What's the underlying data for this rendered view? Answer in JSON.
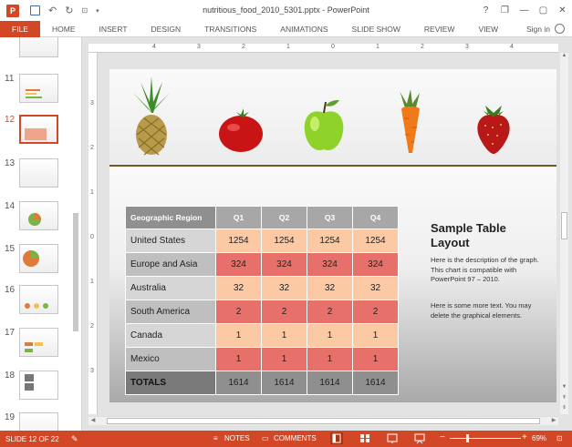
{
  "window": {
    "title": "nutritious_food_2010_5301.pptx - PowerPoint",
    "help": "?",
    "minimize": "—",
    "restore": "❐",
    "close": "✕"
  },
  "ribbon": {
    "file": "FILE",
    "tabs": [
      "HOME",
      "INSERT",
      "DESIGN",
      "TRANSITIONS",
      "ANIMATIONS",
      "SLIDE SHOW",
      "REVIEW",
      "VIEW"
    ],
    "signin": "Sign in"
  },
  "thumbnails": [
    {
      "num": "11",
      "active": false
    },
    {
      "num": "12",
      "active": true
    },
    {
      "num": "13",
      "active": false
    },
    {
      "num": "14",
      "active": false
    },
    {
      "num": "15",
      "active": false
    },
    {
      "num": "16",
      "active": false
    },
    {
      "num": "17",
      "active": false
    },
    {
      "num": "18",
      "active": false
    },
    {
      "num": "19",
      "active": false
    }
  ],
  "ruler": {
    "top_labels": [
      "4",
      "3",
      "2",
      "1",
      "0",
      "1",
      "2",
      "3",
      "4"
    ],
    "left_labels": [
      "3",
      "2",
      "1",
      "0",
      "1",
      "2",
      "3"
    ]
  },
  "slide": {
    "side_title": "Sample Table Layout",
    "side_desc": "Here is the description of the graph.  This chart is compatible with PowerPoint 97 – 2010.",
    "side_desc2": "Here is some more text.  You may delete the graphical elements.",
    "table": {
      "headers": [
        "Geographic Region",
        "Q1",
        "Q2",
        "Q3",
        "Q4"
      ],
      "rows": [
        {
          "label": "United States",
          "values": [
            "1254",
            "1254",
            "1254",
            "1254"
          ]
        },
        {
          "label": "Europe and Asia",
          "values": [
            "324",
            "324",
            "324",
            "324"
          ]
        },
        {
          "label": "Australia",
          "values": [
            "32",
            "32",
            "32",
            "32"
          ]
        },
        {
          "label": "South America",
          "values": [
            "2",
            "2",
            "2",
            "2"
          ]
        },
        {
          "label": "Canada",
          "values": [
            "1",
            "1",
            "1",
            "1"
          ]
        },
        {
          "label": "Mexico",
          "values": [
            "1",
            "1",
            "1",
            "1"
          ]
        }
      ],
      "totals": {
        "label": "TOTALS",
        "values": [
          "1614",
          "1614",
          "1614",
          "1614"
        ]
      }
    }
  },
  "status": {
    "slide_info": "SLIDE 12 OF 22",
    "notes": "NOTES",
    "comments": "COMMENTS",
    "zoom": "69%",
    "zoom_out": "−",
    "zoom_in": "+"
  },
  "colors": {
    "accent": "#d24726",
    "table_light": "#fbc9a3",
    "table_dark": "#e8706a",
    "table_header": "#a7a7a7"
  }
}
